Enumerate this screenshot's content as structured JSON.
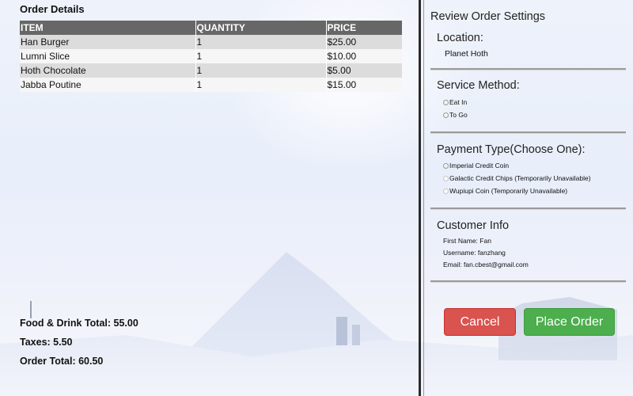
{
  "order": {
    "title": "Order Details",
    "columns": [
      "ITEM",
      "QUANTITY",
      "PRICE"
    ],
    "rows": [
      [
        "Han Burger",
        "1",
        "$25.00"
      ],
      [
        "Lumni Slice",
        "1",
        "$10.00"
      ],
      [
        "Hoth Chocolate",
        "1",
        "$5.00"
      ],
      [
        "Jabba Poutine",
        "1",
        "$15.00"
      ]
    ],
    "food_total": "Food & Drink Total: 55.00",
    "taxes": "Taxes: 5.50",
    "order_total": "Order Total: 60.50"
  },
  "settings": {
    "title": "Review Order Settings",
    "location": {
      "label": "Location:",
      "value": "Planet Hoth"
    },
    "service": {
      "label": "Service Method:",
      "options": [
        "Eat In",
        "To Go"
      ]
    },
    "payment": {
      "label": "Payment Type(Choose One):",
      "options": [
        "Imperial Credit Coin",
        "Galactic Credit Chips (Temporarily Unavailable)",
        "Wupiupi Coin (Temporarily Unavailable)"
      ]
    },
    "customer": {
      "label": "Customer Info",
      "first_name": "First Name: Fan",
      "username": "Username: fanzhang",
      "email": "Email: fan.cbest@gmail.com"
    }
  },
  "buttons": {
    "cancel": "Cancel",
    "place_order": "Place Order"
  },
  "colors": {
    "header_bg": "#676767",
    "cancel": "#d9534f",
    "place_order": "#4cae4c"
  }
}
